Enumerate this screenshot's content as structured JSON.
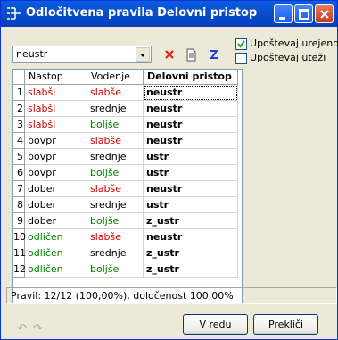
{
  "window": {
    "title": "Odločitvena pravila Delovni pristop",
    "icon": "rules-icon"
  },
  "toolbar": {
    "combo_value": "neustr",
    "delete_icon": "delete-icon",
    "document_icon": "document-icon",
    "sort_icon": "sort-icon"
  },
  "options": {
    "respect_order_label": "Upoštevaj urejenost",
    "respect_order_checked": true,
    "respect_weights_label": "Upoštevaj uteži",
    "respect_weights_checked": false
  },
  "table": {
    "headers": [
      "Nastop",
      "Vodenje",
      "Delovni pristop"
    ],
    "rows": [
      {
        "n": "1",
        "a": "slabši",
        "b": "slabše",
        "c": "neustr"
      },
      {
        "n": "2",
        "a": "slabši",
        "b": "srednje",
        "c": "neustr"
      },
      {
        "n": "3",
        "a": "slabši",
        "b": "boljše",
        "c": "neustr"
      },
      {
        "n": "4",
        "a": "povpr",
        "b": "slabše",
        "c": "neustr"
      },
      {
        "n": "5",
        "a": "povpr",
        "b": "srednje",
        "c": "ustr"
      },
      {
        "n": "6",
        "a": "povpr",
        "b": "boljše",
        "c": "ustr"
      },
      {
        "n": "7",
        "a": "dober",
        "b": "slabše",
        "c": "neustr"
      },
      {
        "n": "8",
        "a": "dober",
        "b": "srednje",
        "c": "ustr"
      },
      {
        "n": "9",
        "a": "dober",
        "b": "boljše",
        "c": "z_ustr"
      },
      {
        "n": "10",
        "a": "odličen",
        "b": "slabše",
        "c": "neustr"
      },
      {
        "n": "11",
        "a": "odličen",
        "b": "srednje",
        "c": "z_ustr"
      },
      {
        "n": "12",
        "a": "odličen",
        "b": "boljše",
        "c": "z_ustr"
      }
    ]
  },
  "colors": {
    "bad": "#d40000",
    "neutral": "#000000",
    "good": "#008000"
  },
  "status": "Pravil: 12/12 (100,00%), določenost 100,00%",
  "footer": {
    "undo_label": "↶",
    "redo_label": "↷",
    "ok_label": "V redu",
    "cancel_label": "Prekliči"
  }
}
